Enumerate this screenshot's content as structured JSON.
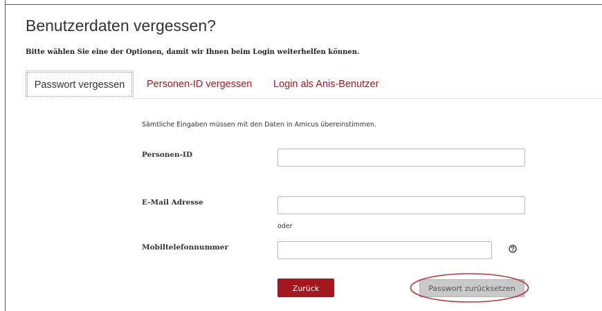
{
  "page": {
    "title": "Benutzerdaten vergessen?",
    "intro": "Bitte wählen Sie eine der Optionen, damit wir Ihnen beim Login weiterhelfen können."
  },
  "tabs": [
    {
      "label": "Passwort vergessen",
      "active": true
    },
    {
      "label": "Personen-ID vergessen",
      "active": false
    },
    {
      "label": "Login als Anis-Benutzer",
      "active": false
    }
  ],
  "form": {
    "hint": "Sämtliche Eingaben müssen mit den Daten in Amicus übereinstimmen.",
    "personen_id": {
      "label": "Personen-ID",
      "value": ""
    },
    "email": {
      "label": "E-Mail Adresse",
      "value": ""
    },
    "separator": "oder",
    "mobile": {
      "label": "Mobiltelefonnummer",
      "value": ""
    }
  },
  "buttons": {
    "back": "Zurück",
    "reset": "Passwort zurücksetzen"
  },
  "icons": {
    "help": "question-circle-icon"
  },
  "colors": {
    "accent": "#a3171f",
    "disabled_button": "#c9c9c9",
    "annotation": "#b03a3a"
  }
}
